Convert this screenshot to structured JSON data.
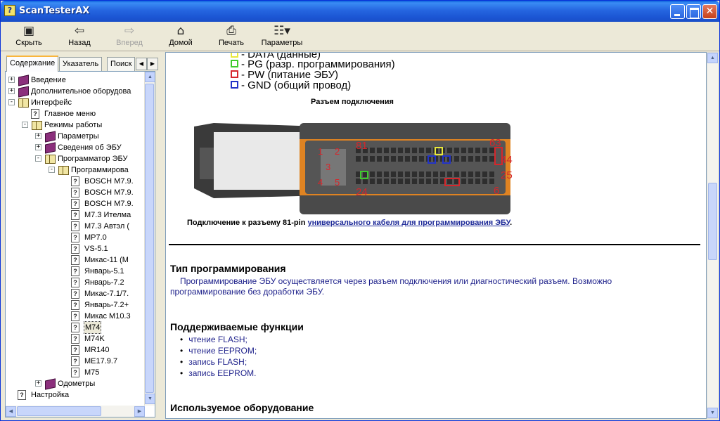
{
  "window": {
    "title": "ScanTesterAX"
  },
  "toolbar": {
    "hide": "Скрыть",
    "back": "Назад",
    "forward": "Вперед",
    "home": "Домой",
    "print": "Печать",
    "options": "Параметры"
  },
  "tabs": {
    "contents": "Содержание",
    "index": "Указатель",
    "search": "Поиск"
  },
  "tree": {
    "n0": "Введение",
    "n1": "Дополнительное оборудова",
    "n2": "Интерфейс",
    "n3": "Главное меню",
    "n4": "Режимы работы",
    "n5": "Параметры",
    "n6": "Сведения об ЭБУ",
    "n7": "Программатор ЭБУ",
    "n8": "Программирова",
    "n9": "BOSCH M7.9.",
    "n10": "BOSCH M7.9.",
    "n11": "BOSCH M7.9.",
    "n12": "M7.3 Ителма",
    "n13": "M7.3 Автэл (",
    "n14": "MP7.0",
    "n15": "VS-5.1",
    "n16": "Микас-11 (М",
    "n17": "Январь-5.1",
    "n18": "Январь-7.2",
    "n19": "Микас-7.1/7.",
    "n20": "Январь-7.2+",
    "n21": "Микас М10.3",
    "n22": "M74",
    "n23": "M74K",
    "n24": "MR140",
    "n25": "ME17.9.7",
    "n26": "M75",
    "n27": "Одометры",
    "n28": "Настройка"
  },
  "legend": [
    {
      "label": "- DATA (данные)",
      "color": "#E8E83A"
    },
    {
      "label": "- PG (разр. программирования)",
      "color": "#3FCB2E"
    },
    {
      "label": "- PW (питание ЭБУ)",
      "color": "#D6262B"
    },
    {
      "label": "- GND (общий провод)",
      "color": "#2233C8"
    }
  ],
  "connector": {
    "title": "Разъем подключения",
    "pins": {
      "p81": "81",
      "p63": "63",
      "p44": "44",
      "p25": "25",
      "p24": "24",
      "p6": "6",
      "p1": "1",
      "p2": "2",
      "p3": "3",
      "p4": "4",
      "p5": "5"
    },
    "caption": "Подключение к разъему 81-pin ",
    "caption_link": "универсального кабеля для программирования ЭБУ",
    "caption_end": "."
  },
  "sections": {
    "prog_type_title": "Тип программирования",
    "prog_type_text": "Программирование ЭБУ осуществляется через разъем подключения или диагностический разъем. Возможно программирование без доработки ЭБУ.",
    "functions_title": "Поддерживаемые функции",
    "functions": [
      "чтение FLASH;",
      "чтение EEPROM;",
      "запись FLASH;",
      "запись EEPROM."
    ],
    "equipment_title": "Используемое оборудование"
  },
  "colors": {
    "titlebar": "#2566E0",
    "link": "#1F2B99",
    "text": "#1C1F8A",
    "pin_red": "#D6262B"
  }
}
